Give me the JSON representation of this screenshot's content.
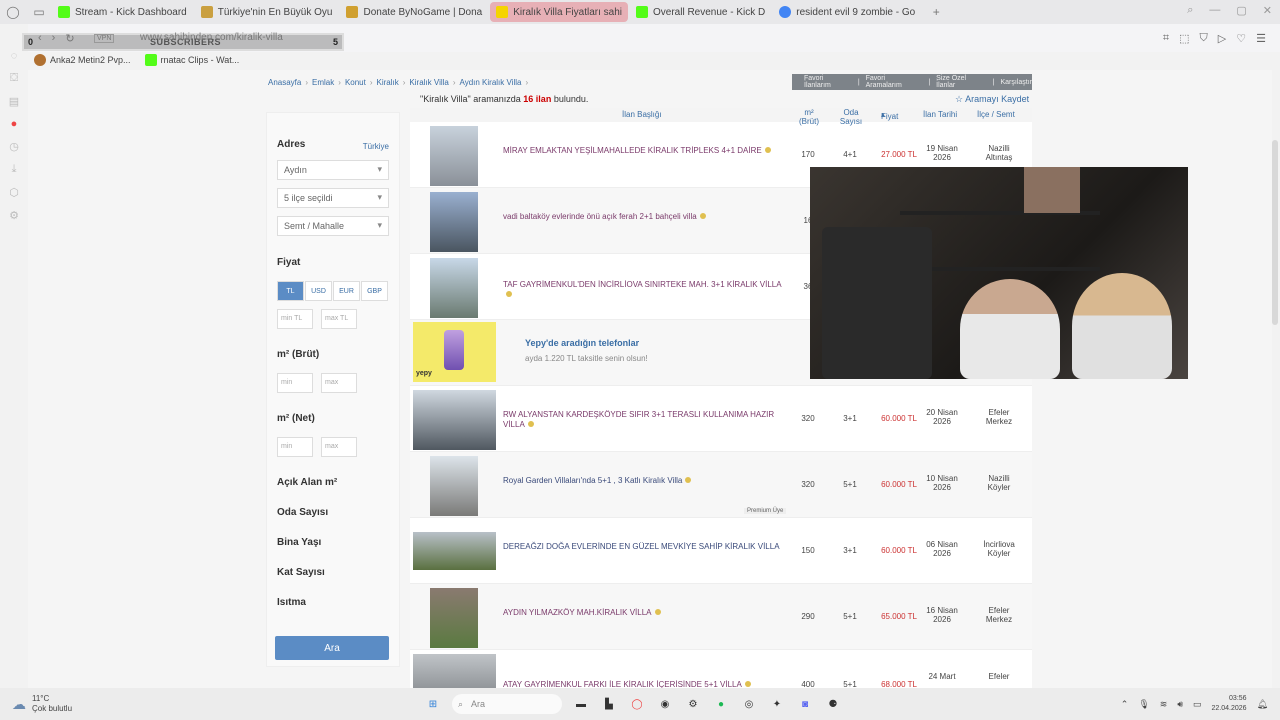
{
  "browser": {
    "tabs": [
      {
        "label": "Stream - Kick Dashboard",
        "color": "#53fc18",
        "active": false
      },
      {
        "label": "Türkiye'nin En Büyük Oyu",
        "color": "#caa040",
        "active": false
      },
      {
        "label": "Donate ByNoGame | Dona",
        "color": "#d0a030",
        "active": false
      },
      {
        "label": "Kiralık Villa Fiyatları sahi",
        "color": "#f5d400",
        "active": true
      },
      {
        "label": "Overall Revenue - Kick D",
        "color": "#53fc18",
        "active": false
      },
      {
        "label": "resident evil 9 zombie - Go",
        "color": "#4285f4",
        "active": false
      }
    ],
    "new_tab": "+",
    "url": "www.sahibinden.com/kiralik-villa",
    "vpn": "VPN",
    "subs_overlay": {
      "label": "SUBSCRIBERS",
      "left": "0",
      "right": "5"
    },
    "bookmarks": [
      "Anka2 Metin2 Pvp...",
      "rnatac Clips - Wat..."
    ]
  },
  "page": {
    "breadcrumb": [
      "Anasayfa",
      "Emlak",
      "Konut",
      "Kiralık",
      "Kiralık Villa",
      "Aydın Kiralık Villa"
    ],
    "topnav": [
      "Favori İlanlarım",
      "Favori Aramalarım",
      "Size Özel İlanlar",
      "Karşılaştır"
    ],
    "result_prefix": "\"Kiralık Villa\" aramanızda",
    "result_count": "16 ilan",
    "result_suffix": "bulundu.",
    "save_search": "Aramayı Kaydet"
  },
  "filters": {
    "address_title": "Adres",
    "country_link": "Türkiye",
    "city": "Aydın",
    "district": "5 ilçe seçildi",
    "neighborhood": "Semt / Mahalle",
    "price_title": "Fiyat",
    "currencies": [
      "TL",
      "USD",
      "EUR",
      "GBP"
    ],
    "min_tl": "min TL",
    "max_tl": "max TL",
    "m2_brut_title": "m² (Brüt)",
    "m2_net_title": "m² (Net)",
    "min": "min",
    "max": "max",
    "extra": [
      "Açık Alan m²",
      "Oda Sayısı",
      "Bina Yaşı",
      "Kat Sayısı",
      "Isıtma"
    ],
    "search_button": "Ara"
  },
  "table": {
    "headers": [
      "İlan Başlığı",
      "m² (Brüt)",
      "Oda Sayısı",
      "Fiyat",
      "İlan Tarihi",
      "İlçe / Semt"
    ],
    "rows": [
      {
        "title": "MİRAY EMLAKTAN YEŞİLMAHALLEDE KİRALIK TRİPLEKS 4+1 DAİRE",
        "m2": "170",
        "room": "4+1",
        "price": "27.000 TL",
        "date1": "19 Nisan",
        "date2": "2026",
        "loc1": "Nazilli",
        "loc2": "Altıntaş"
      },
      {
        "title": "vadi baltaköy evlerinde önü açık ferah 2+1 bahçeli villa",
        "m2": "16",
        "room": "",
        "price": "",
        "date1": "",
        "date2": "",
        "loc1": "",
        "loc2": ""
      },
      {
        "title": "TAF GAYRİMENKUL'DEN İNCİRLİOVA SINIRTEKE MAH. 3+1 KİRALIK VİLLA",
        "m2": "36",
        "room": "",
        "price": "",
        "date1": "",
        "date2": "",
        "loc1": "",
        "loc2": ""
      },
      {
        "title": "RW ALYANSTAN KARDEŞKÖYDE SIFIR 3+1 TERASLI KULLANIMA HAZIR VİLLA",
        "m2": "320",
        "room": "3+1",
        "price": "60.000 TL",
        "date1": "20 Nisan",
        "date2": "2026",
        "loc1": "Efeler",
        "loc2": "Merkez"
      },
      {
        "title": "Royal Garden Villaları'nda 5+1 , 3 Katlı Kiralık Villa",
        "m2": "320",
        "room": "5+1",
        "price": "60.000 TL",
        "date1": "10 Nisan",
        "date2": "2026",
        "loc1": "Nazilli",
        "loc2": "Köyler"
      },
      {
        "title": "DEREAĞZI DOĞA EVLERİNDE EN GÜZEL MEVKİYE SAHİP KİRALIK VİLLA",
        "m2": "150",
        "room": "3+1",
        "price": "60.000 TL",
        "date1": "06 Nisan",
        "date2": "2026",
        "loc1": "İncirliova",
        "loc2": "Köyler"
      },
      {
        "title": "AYDIN YILMAZKÖY MAH.KİRALIK VİLLA",
        "m2": "290",
        "room": "5+1",
        "price": "65.000 TL",
        "date1": "16 Nisan",
        "date2": "2026",
        "loc1": "Efeler",
        "loc2": "Merkez"
      },
      {
        "title": "ATAY GAYRİMENKUL FARKI İLE KİRALIK İÇERİSİNDE 5+1 VİLLA",
        "m2": "400",
        "room": "5+1",
        "price": "68.000 TL",
        "date1": "24 Mart",
        "date2": "",
        "loc1": "Efeler",
        "loc2": ""
      }
    ],
    "ad": {
      "title": "Yepy'de aradığın telefonlar",
      "subtitle": "ayda 1.220 TL taksitle senin olsun!",
      "brand": "yepy"
    },
    "premium_badge": "Premium Üye"
  },
  "taskbar": {
    "temp": "11°C",
    "weather": "Çok bulutlu",
    "search": "Ara",
    "time": "03:56",
    "date": "22.04.2026"
  },
  "colors": {
    "accent": "#5b8cc5",
    "price": "#cc3333",
    "title": "#7a3a6a",
    "link": "#3a6ea5"
  }
}
